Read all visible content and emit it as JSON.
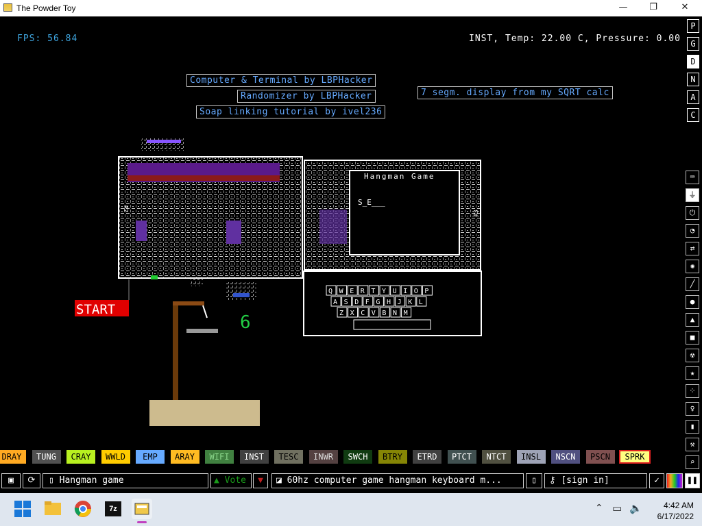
{
  "window": {
    "title": "The Powder Toy",
    "minimize": "—",
    "maximize": "❐",
    "close": "✕"
  },
  "hud": {
    "fps": "FPS: 56.84",
    "status": "INST, Temp: 22.00 C, Pressure: 0.00"
  },
  "signs": {
    "computer": "Computer & Terminal by LBPHacker",
    "randomizer": "Randomizer by LBPHacker",
    "soap": "Soap linking tutorial by ivel236",
    "segm": "7 segm. display from my SQRT calc"
  },
  "scene": {
    "terminal_title": "Hangman Game",
    "terminal_word": "S_E___",
    "start_label": "START",
    "digit": "6",
    "r2_label": "R2",
    "r3_label": "R3",
    "keyboard_rows": [
      [
        "Q",
        "W",
        "E",
        "R",
        "T",
        "Y",
        "U",
        "I",
        "O",
        "P"
      ],
      [
        "A",
        "S",
        "D",
        "F",
        "G",
        "H",
        "J",
        "K",
        "L"
      ],
      [
        "Z",
        "X",
        "C",
        "V",
        "B",
        "N",
        "M"
      ]
    ]
  },
  "render_modes": [
    "P",
    "G",
    "D",
    "N",
    "A",
    "C"
  ],
  "tool_icons": [
    "keyboard-icon",
    "plug-icon",
    "power-icon",
    "gauge-icon",
    "arrows-icon",
    "fire-icon",
    "brush-icon",
    "drop-icon",
    "flask-icon",
    "square-icon",
    "radiation-icon",
    "star-icon",
    "dots-icon",
    "bulb-icon",
    "bookmark-icon",
    "wrench-icon",
    "search-icon"
  ],
  "elements": [
    {
      "label": "DRAY",
      "bg": "#ffaa22",
      "fg": "#000"
    },
    {
      "label": "TUNG",
      "bg": "#505050",
      "fg": "#fff"
    },
    {
      "label": "CRAY",
      "bg": "#b8f020",
      "fg": "#000"
    },
    {
      "label": "WWLD",
      "bg": "#ffcc00",
      "fg": "#000"
    },
    {
      "label": "EMP",
      "bg": "#66aaff",
      "fg": "#000"
    },
    {
      "label": "ARAY",
      "bg": "#ffbb22",
      "fg": "#000"
    },
    {
      "label": "WIFI",
      "bg": "#408040",
      "fg": "#8cd88c"
    },
    {
      "label": "INST",
      "bg": "#404040",
      "fg": "#fff"
    },
    {
      "label": "TESC",
      "bg": "#707060",
      "fg": "#000"
    },
    {
      "label": "INWR",
      "bg": "#544141",
      "fg": "#ddd"
    },
    {
      "label": "SWCH",
      "bg": "#103b11",
      "fg": "#fff"
    },
    {
      "label": "BTRY",
      "bg": "#858505",
      "fg": "#000"
    },
    {
      "label": "ETRD",
      "bg": "#404040",
      "fg": "#fff"
    },
    {
      "label": "PTCT",
      "bg": "#405050",
      "fg": "#fff"
    },
    {
      "label": "NTCT",
      "bg": "#505040",
      "fg": "#fff"
    },
    {
      "label": "INSL",
      "bg": "#9ea3b6",
      "fg": "#000"
    },
    {
      "label": "NSCN",
      "bg": "#505080",
      "fg": "#fff"
    },
    {
      "label": "PSCN",
      "bg": "#805050",
      "fg": "#000"
    },
    {
      "label": "SPRK",
      "bg": "#ffff80",
      "fg": "#000"
    }
  ],
  "bottom": {
    "save_name": "Hangman game",
    "vote": "Vote",
    "description": "60hz computer game hangman keyboard m...",
    "signin": "[sign in]"
  },
  "taskbar": {
    "time": "4:42 AM",
    "date": "6/17/2022",
    "zip_label": "7z"
  }
}
